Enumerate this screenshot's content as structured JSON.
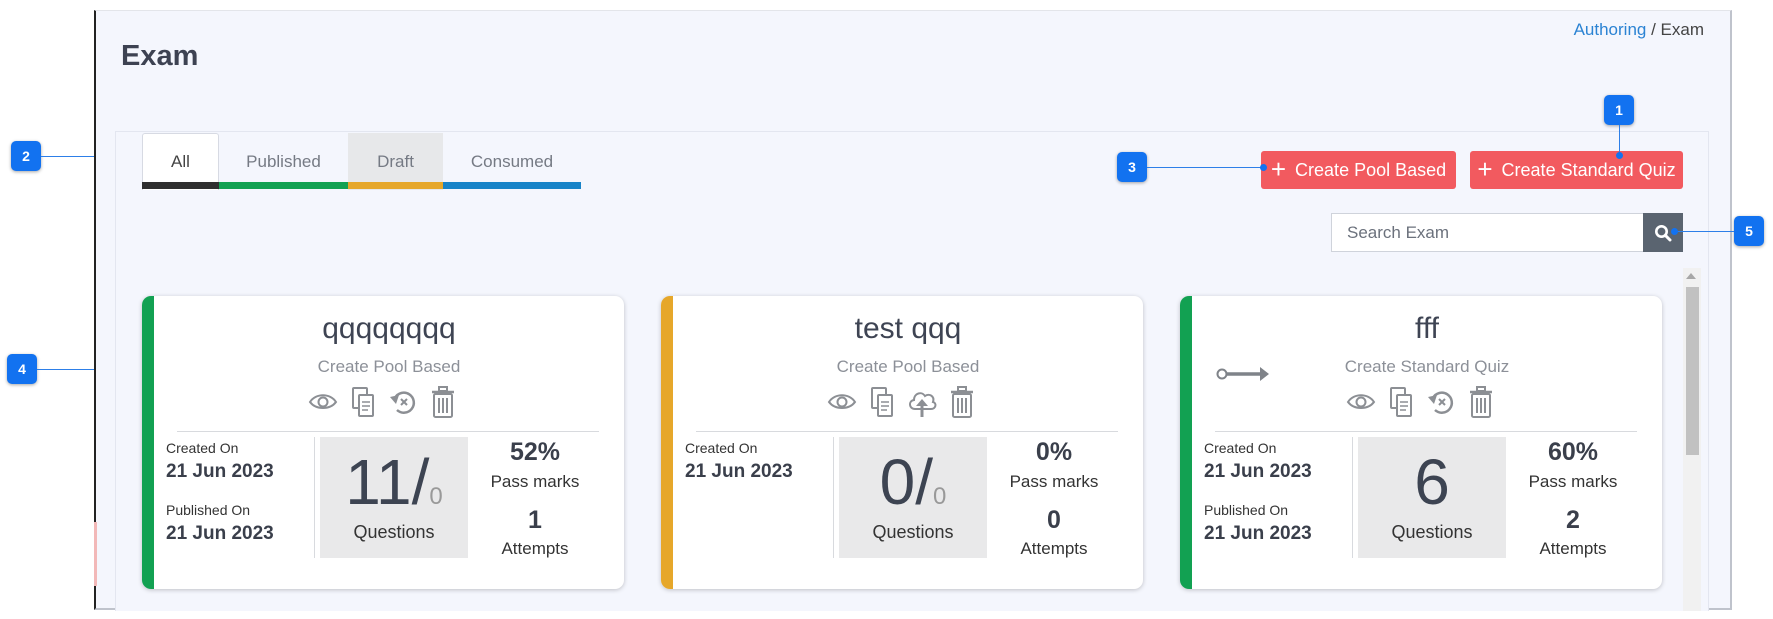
{
  "page": {
    "title": "Exam"
  },
  "breadcrumb": {
    "parent": "Authoring",
    "separator": " / ",
    "current": "Exam"
  },
  "colors": {
    "published": "#12a152",
    "draft": "#e6a72a",
    "all": "#2f2f2f",
    "consumed": "#1783c8",
    "accent": "#f25a5f"
  },
  "tabs": [
    {
      "label": "All"
    },
    {
      "label": "Published"
    },
    {
      "label": "Draft"
    },
    {
      "label": "Consumed"
    }
  ],
  "buttons": {
    "create_pool": "Create Pool Based",
    "create_standard": "Create Standard Quiz"
  },
  "search": {
    "placeholder": "Search Exam",
    "icon": "search-icon"
  },
  "cards": [
    {
      "title": "qqqqqqqq",
      "type": "Create Pool Based",
      "status": "published",
      "icons": [
        "eye-icon",
        "copy-icon",
        "revert-icon",
        "trash-icon"
      ],
      "created_label": "Created On",
      "created_date": "21 Jun 2023",
      "published_label": "Published On",
      "published_date": "21 Jun 2023",
      "questions_main": "11/",
      "questions_sub": "0",
      "questions_label": "Questions",
      "pass_value": "52%",
      "pass_label": "Pass marks",
      "attempts_value": "1",
      "attempts_label": "Attempts"
    },
    {
      "title": "test qqq",
      "type": "Create Pool Based",
      "status": "draft",
      "icons": [
        "eye-icon",
        "copy-icon",
        "publish-upload-icon",
        "trash-icon"
      ],
      "created_label": "Created On",
      "created_date": "21 Jun 2023",
      "questions_main": "0/",
      "questions_sub": "0",
      "questions_label": "Questions",
      "pass_value": "0%",
      "pass_label": "Pass marks",
      "attempts_value": "0",
      "attempts_label": "Attempts"
    },
    {
      "title": "fff",
      "type": "Create Standard Quiz",
      "status": "published",
      "icons": [
        "key-icon",
        "eye-icon",
        "copy-icon",
        "revert-icon",
        "trash-icon"
      ],
      "created_label": "Created On",
      "created_date": "21 Jun 2023",
      "published_label": "Published On",
      "published_date": "21 Jun 2023",
      "questions_main": "6",
      "questions_label": "Questions",
      "pass_value": "60%",
      "pass_label": "Pass marks",
      "attempts_value": "2",
      "attempts_label": "Attempts"
    }
  ],
  "annotations": [
    "1",
    "2",
    "3",
    "4",
    "5"
  ]
}
